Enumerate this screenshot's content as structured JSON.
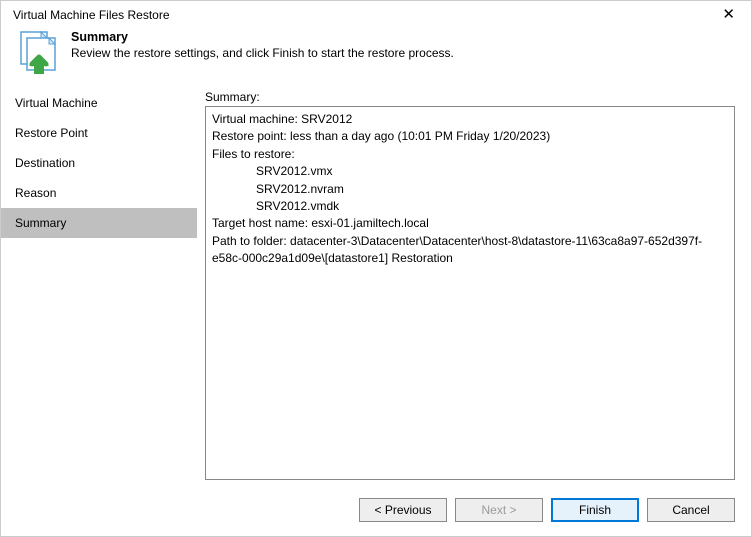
{
  "window": {
    "title": "Virtual Machine Files Restore"
  },
  "header": {
    "title": "Summary",
    "subtitle": "Review the restore settings, and click Finish to start the restore process."
  },
  "sidebar": {
    "items": [
      {
        "label": "Virtual Machine"
      },
      {
        "label": "Restore Point"
      },
      {
        "label": "Destination"
      },
      {
        "label": "Reason"
      },
      {
        "label": "Summary"
      }
    ]
  },
  "content": {
    "label": "Summary:",
    "summary": {
      "vm_line": "Virtual machine: SRV2012",
      "restore_point_line": "Restore point: less than a day ago (10:01 PM Friday 1/20/2023)",
      "files_label": "Files to restore:",
      "files": [
        "SRV2012.vmx",
        "SRV2012.nvram",
        "SRV2012.vmdk"
      ],
      "target_host_line": "Target host name: esxi-01.jamiltech.local",
      "path_line": "Path to folder: datacenter-3\\Datacenter\\Datacenter\\host-8\\datastore-11\\63ca8a97-652d397f-e58c-000c29a1d09e\\[datastore1] Restoration"
    }
  },
  "footer": {
    "previous": "< Previous",
    "next": "Next >",
    "finish": "Finish",
    "cancel": "Cancel"
  }
}
